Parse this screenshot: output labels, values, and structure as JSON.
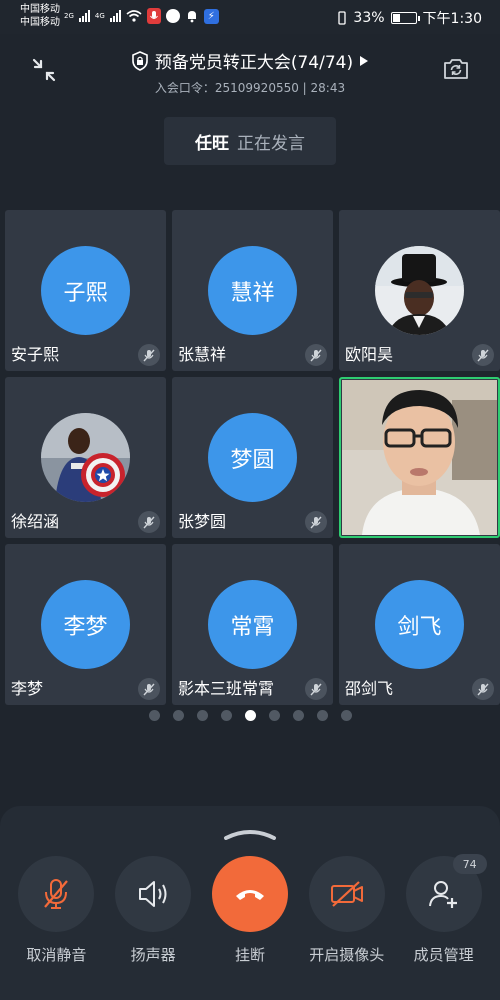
{
  "status_bar": {
    "carrier_1": "中国移动",
    "carrier_2": "中国移动",
    "net_1": "2G",
    "net_2": "4G",
    "battery": "33%",
    "time": "下午1:30"
  },
  "meeting": {
    "title": "预备党员转正大会(74/74)",
    "subtitle": "入会口令：25109920550 | 28:43"
  },
  "speaking": {
    "name": "任旺",
    "status": "正在发言"
  },
  "participants": [
    {
      "initials": "子熙",
      "name": "安子熙",
      "type": "initials"
    },
    {
      "initials": "慧祥",
      "name": "张慧祥",
      "type": "initials"
    },
    {
      "initials": "",
      "name": "欧阳昊",
      "type": "photo"
    },
    {
      "initials": "",
      "name": "徐绍涵",
      "type": "photo"
    },
    {
      "initials": "梦圆",
      "name": "张梦圆",
      "type": "initials"
    },
    {
      "initials": "",
      "name": "",
      "type": "video"
    },
    {
      "initials": "李梦",
      "name": "李梦",
      "type": "initials"
    },
    {
      "initials": "常霄",
      "name": "影本三班常霄",
      "type": "initials"
    },
    {
      "initials": "剑飞",
      "name": "邵剑飞",
      "type": "initials"
    }
  ],
  "pagination": {
    "pages": 9,
    "current_page": 5
  },
  "controls": {
    "unmute": "取消静音",
    "speaker": "扬声器",
    "hangup": "挂断",
    "camera": "开启摄像头",
    "members": "成员管理",
    "member_count": "74"
  },
  "colors": {
    "background": "#1f252d",
    "avatar_blue": "#3d96ea",
    "hangup_orange": "#f26a3a",
    "active_green": "#2ecc71"
  }
}
